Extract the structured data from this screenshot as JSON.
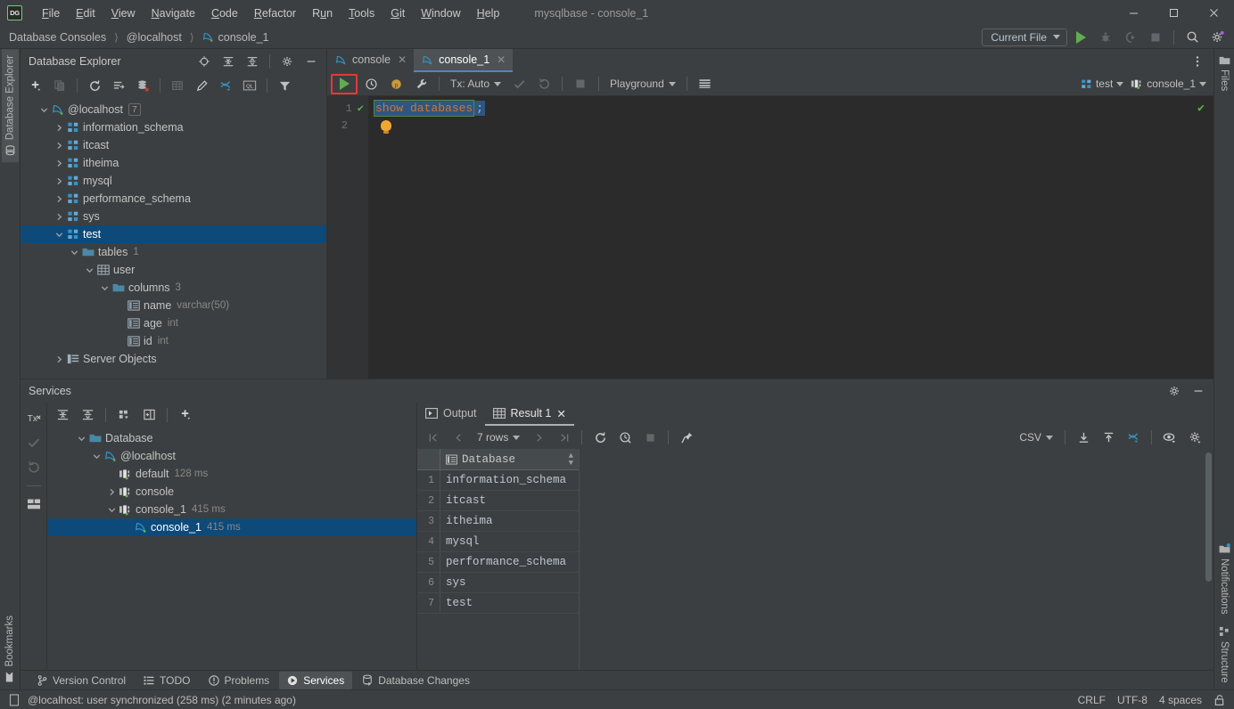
{
  "titlebar": {
    "logo": "DG",
    "window_title": "mysqlbase - console_1",
    "menus": [
      {
        "label": "File",
        "mnemonic": "F"
      },
      {
        "label": "Edit",
        "mnemonic": "E"
      },
      {
        "label": "View",
        "mnemonic": "V"
      },
      {
        "label": "Navigate",
        "mnemonic": "N"
      },
      {
        "label": "Code",
        "mnemonic": "C"
      },
      {
        "label": "Refactor",
        "mnemonic": "R"
      },
      {
        "label": "Run",
        "mnemonic": "u"
      },
      {
        "label": "Tools",
        "mnemonic": "T"
      },
      {
        "label": "Git",
        "mnemonic": "G"
      },
      {
        "label": "Window",
        "mnemonic": "W"
      },
      {
        "label": "Help",
        "mnemonic": "H"
      }
    ],
    "minimize": "—",
    "maximize": "□",
    "close": "✕"
  },
  "navbar": {
    "breadcrumbs": [
      "Database Consoles",
      "@localhost",
      "console_1"
    ],
    "run_config": "Current File",
    "actions": [
      "run-icon",
      "debug-icon",
      "run-coverage-icon",
      "stop-icon",
      "search-everywhere-icon",
      "settings-icon"
    ]
  },
  "left_strip": {
    "top": [
      {
        "label": "Database Explorer",
        "icon": "database-icon",
        "active": true
      }
    ],
    "bottom": [
      {
        "label": "Bookmarks",
        "icon": "bookmark-icon",
        "active": false
      }
    ]
  },
  "right_strip": {
    "top": [
      {
        "label": "Files",
        "icon": "folder-icon"
      }
    ],
    "bottom": [
      {
        "label": "Notifications",
        "icon": "notification-icon"
      },
      {
        "label": "Structure",
        "icon": "structure-icon"
      }
    ]
  },
  "explorer": {
    "title": "Database Explorer",
    "head_actions": [
      "locate-icon",
      "expand-all-icon",
      "collapse-all-icon",
      "gear-icon",
      "hide-icon"
    ],
    "toolbar": [
      "add-icon",
      "duplicate-icon",
      "refresh-icon",
      "sync-icon",
      "db-color-icon",
      "table-editor-icon",
      "edit-icon",
      "jump-to-icon",
      "ql-console-icon",
      "filter-icon"
    ],
    "tree": [
      {
        "label": "@localhost",
        "icon": "mysql-icon",
        "indent": 0,
        "arrow": "down",
        "badge": "7",
        "selected": false
      },
      {
        "label": "information_schema",
        "icon": "schema-icon",
        "indent": 1,
        "arrow": "right",
        "selected": false
      },
      {
        "label": "itcast",
        "icon": "schema-icon",
        "indent": 1,
        "arrow": "right",
        "selected": false
      },
      {
        "label": "itheima",
        "icon": "schema-icon",
        "indent": 1,
        "arrow": "right",
        "selected": false
      },
      {
        "label": "mysql",
        "icon": "schema-icon",
        "indent": 1,
        "arrow": "right",
        "selected": false
      },
      {
        "label": "performance_schema",
        "icon": "schema-icon",
        "indent": 1,
        "arrow": "right",
        "selected": false
      },
      {
        "label": "sys",
        "icon": "schema-icon",
        "indent": 1,
        "arrow": "right",
        "selected": false
      },
      {
        "label": "test",
        "icon": "schema-icon",
        "indent": 1,
        "arrow": "down",
        "selected": true
      },
      {
        "label": "tables",
        "icon": "folder-icon",
        "indent": 2,
        "arrow": "down",
        "count": "1",
        "selected": false
      },
      {
        "label": "user",
        "icon": "table-icon",
        "indent": 3,
        "arrow": "down",
        "selected": false
      },
      {
        "label": "columns",
        "icon": "folder-icon",
        "indent": 4,
        "arrow": "down",
        "count": "3",
        "selected": false
      },
      {
        "label": "name",
        "icon": "column-icon",
        "indent": 5,
        "arrow": "none",
        "type": "varchar(50)",
        "selected": false
      },
      {
        "label": "age",
        "icon": "column-icon",
        "indent": 5,
        "arrow": "none",
        "type": "int",
        "selected": false
      },
      {
        "label": "id",
        "icon": "column-icon",
        "indent": 5,
        "arrow": "none",
        "type": "int",
        "selected": false
      },
      {
        "label": "Server Objects",
        "icon": "server-objects-icon",
        "indent": 1,
        "arrow": "right",
        "selected": false
      }
    ]
  },
  "editor": {
    "tabs": [
      {
        "label": "console",
        "icon": "mysql-icon",
        "active": false
      },
      {
        "label": "console_1",
        "icon": "mysql-icon",
        "active": true
      }
    ],
    "toolbar": {
      "execute": "execute-icon",
      "history": "history-icon",
      "profile": "profile-icon",
      "wrench": "wrench-icon",
      "tx_mode": "Tx: Auto",
      "commit": "commit-icon",
      "rollback": "rollback-icon",
      "stop": "stop-icon",
      "schema": "Playground",
      "grid_icon": "table-grid-icon"
    },
    "session": {
      "schema": "test",
      "console": "console_1"
    },
    "gutter_lines": [
      "1",
      "2"
    ],
    "code": {
      "keyword": "show databases",
      "terminator": ";"
    },
    "inspection_ok": "✔"
  },
  "services": {
    "title": "Services",
    "head_actions": [
      "gear-icon",
      "hide-icon"
    ],
    "left_tools": [
      "tx-icon",
      "commit-icon",
      "rollback-icon",
      "layout-icon"
    ],
    "toolbar": [
      "expand-all-icon",
      "collapse-all-icon",
      "group-icon",
      "new-tab-icon",
      "add-icon"
    ],
    "tree": [
      {
        "label": "Database",
        "icon": "folder-icon",
        "indent": 0,
        "arrow": "down",
        "selected": false
      },
      {
        "label": "@localhost",
        "icon": "mysql-icon",
        "indent": 1,
        "arrow": "down",
        "selected": false
      },
      {
        "label": "default",
        "icon": "session-icon",
        "indent": 2,
        "arrow": "none",
        "time": "128 ms",
        "selected": false
      },
      {
        "label": "console",
        "icon": "session-icon",
        "indent": 2,
        "arrow": "right",
        "selected": false
      },
      {
        "label": "console_1",
        "icon": "session-icon",
        "indent": 2,
        "arrow": "down",
        "time": "415 ms",
        "selected": false
      },
      {
        "label": "console_1",
        "icon": "mysql-icon",
        "indent": 3,
        "arrow": "none",
        "time": "415 ms",
        "selected": true
      }
    ]
  },
  "results": {
    "tabs": [
      {
        "label": "Output",
        "icon": "output-icon",
        "active": false,
        "closable": false
      },
      {
        "label": "Result 1",
        "icon": "table-grid-icon",
        "active": true,
        "closable": true
      }
    ],
    "pager": {
      "first": "first-page-icon",
      "prev": "prev-page-icon",
      "rows": "7 rows",
      "next": "next-page-icon",
      "last": "last-page-icon"
    },
    "actions": [
      "refresh-icon",
      "query-time-icon",
      "stop-icon",
      "pin-icon"
    ],
    "export_format": "CSV",
    "right_actions": [
      "import-icon",
      "export-icon",
      "transpose-icon",
      "view-options-icon",
      "settings-icon"
    ],
    "grid": {
      "columns": [
        "Database"
      ],
      "rows": [
        {
          "n": "1",
          "Database": "information_schema"
        },
        {
          "n": "2",
          "Database": "itcast"
        },
        {
          "n": "3",
          "Database": "itheima"
        },
        {
          "n": "4",
          "Database": "mysql"
        },
        {
          "n": "5",
          "Database": "performance_schema"
        },
        {
          "n": "6",
          "Database": "sys"
        },
        {
          "n": "7",
          "Database": "test"
        }
      ]
    }
  },
  "bottom_bar": {
    "items": [
      {
        "label": "Version Control",
        "icon": "branch-icon",
        "active": false
      },
      {
        "label": "TODO",
        "icon": "todo-icon",
        "active": false
      },
      {
        "label": "Problems",
        "icon": "problems-icon",
        "active": false
      },
      {
        "label": "Services",
        "icon": "services-icon",
        "active": true
      },
      {
        "label": "Database Changes",
        "icon": "db-changes-icon",
        "active": false
      }
    ]
  },
  "statusbar": {
    "message": "@localhost: user synchronized (258 ms) (2 minutes ago)",
    "line_sep": "CRLF",
    "encoding": "UTF-8",
    "indent": "4 spaces",
    "lock": "lock-icon"
  },
  "colors": {
    "accent_blue": "#4a88c7",
    "selection_blue": "#0d4a7a",
    "run_green": "#5fad4e",
    "highlight_red": "#e53935",
    "keyword_orange": "#cc7832"
  }
}
